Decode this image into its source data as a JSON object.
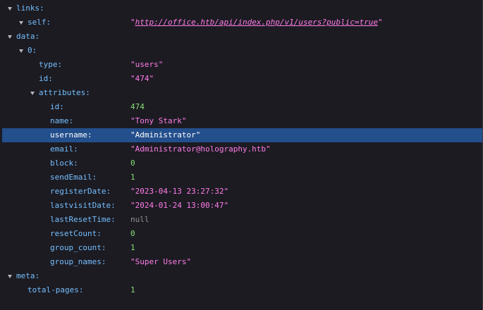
{
  "rows": [
    {
      "key": "links:"
    },
    {
      "key": "self:",
      "prefix": "\"",
      "value": "http://office.htb/api/index.php/v1/users?public=true",
      "suffix": "\""
    },
    {
      "key": "data:"
    },
    {
      "key": "0:"
    },
    {
      "key": "type:",
      "value": "\"users\""
    },
    {
      "key": "id:",
      "value": "\"474\""
    },
    {
      "key": "attributes:"
    },
    {
      "key": "id:",
      "value": "474"
    },
    {
      "key": "name:",
      "value": "\"Tony Stark\""
    },
    {
      "key": "username:",
      "value": "\"Administrator\""
    },
    {
      "key": "email:",
      "value": "\"Administrator@holography.htb\""
    },
    {
      "key": "block:",
      "value": "0"
    },
    {
      "key": "sendEmail:",
      "value": "1"
    },
    {
      "key": "registerDate:",
      "value": "\"2023-04-13 23:27:32\""
    },
    {
      "key": "lastvisitDate:",
      "value": "\"2024-01-24 13:00:47\""
    },
    {
      "key": "lastResetTime:",
      "value": "null"
    },
    {
      "key": "resetCount:",
      "value": "0"
    },
    {
      "key": "group_count:",
      "value": "1"
    },
    {
      "key": "group_names:",
      "value": "\"Super Users\""
    },
    {
      "key": "meta:"
    },
    {
      "key": "total-pages:",
      "value": "1"
    }
  ]
}
